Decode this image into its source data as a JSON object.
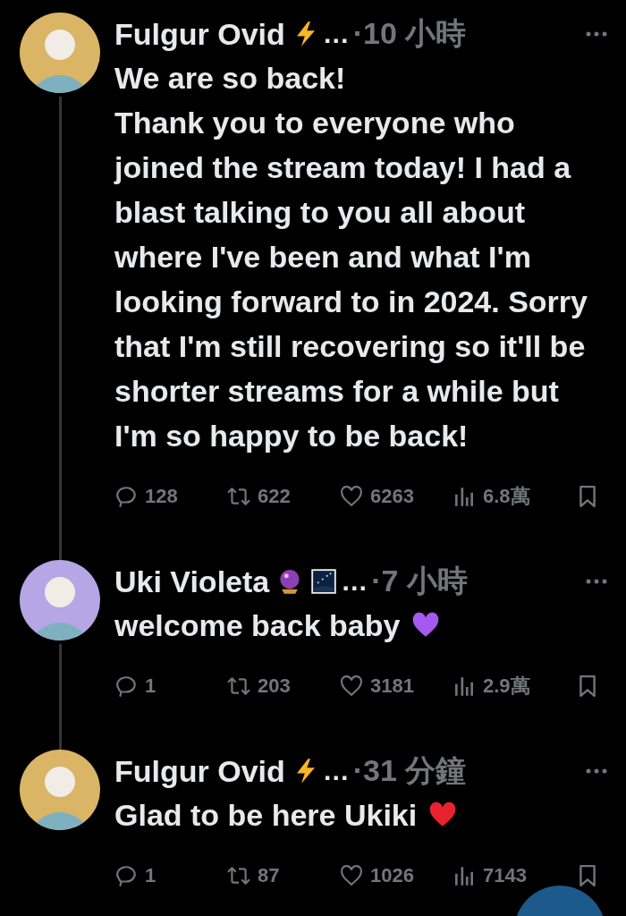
{
  "tweets": [
    {
      "avatar": {
        "color": "#d9b565"
      },
      "name": "Fulgur Ovid",
      "badges": [
        {
          "kind": "lightning"
        }
      ],
      "ellipsis": "…",
      "time": "·10 小時",
      "thread_above": false,
      "thread_below": true,
      "body": [
        "We are so back!",
        "Thank you to everyone who joined the stream today! I had a blast talking to you all about where I've been and what I'm looking forward to in 2024. Sorry that I'm still recovering so it'll be shorter streams for a while but I'm so happy to be back!"
      ],
      "stats": {
        "replies": "128",
        "reposts": "622",
        "likes": "6263",
        "views": "6.8萬"
      }
    },
    {
      "avatar": {
        "color": "#b7a6e6"
      },
      "name": "Uki Violeta",
      "badges": [
        {
          "kind": "crystal-ball"
        },
        {
          "kind": "night-sky"
        }
      ],
      "ellipsis": "…",
      "time": "·7 小時",
      "thread_above": true,
      "thread_below": true,
      "body": [
        "welcome back baby"
      ],
      "emoji": {
        "kind": "heart",
        "color": "#a659f0"
      },
      "stats": {
        "replies": "1",
        "reposts": "203",
        "likes": "3181",
        "views": "2.9萬"
      }
    },
    {
      "avatar": {
        "color": "#d9b565"
      },
      "name": "Fulgur Ovid",
      "badges": [
        {
          "kind": "lightning"
        }
      ],
      "ellipsis": "…",
      "time": "·31 分鐘",
      "thread_above": true,
      "thread_below": false,
      "body": [
        "Glad to be here Ukiki"
      ],
      "emoji": {
        "kind": "heart",
        "color": "#e8222e"
      },
      "stats": {
        "replies": "1",
        "reposts": "87",
        "likes": "1026",
        "views": "7143"
      }
    }
  ]
}
